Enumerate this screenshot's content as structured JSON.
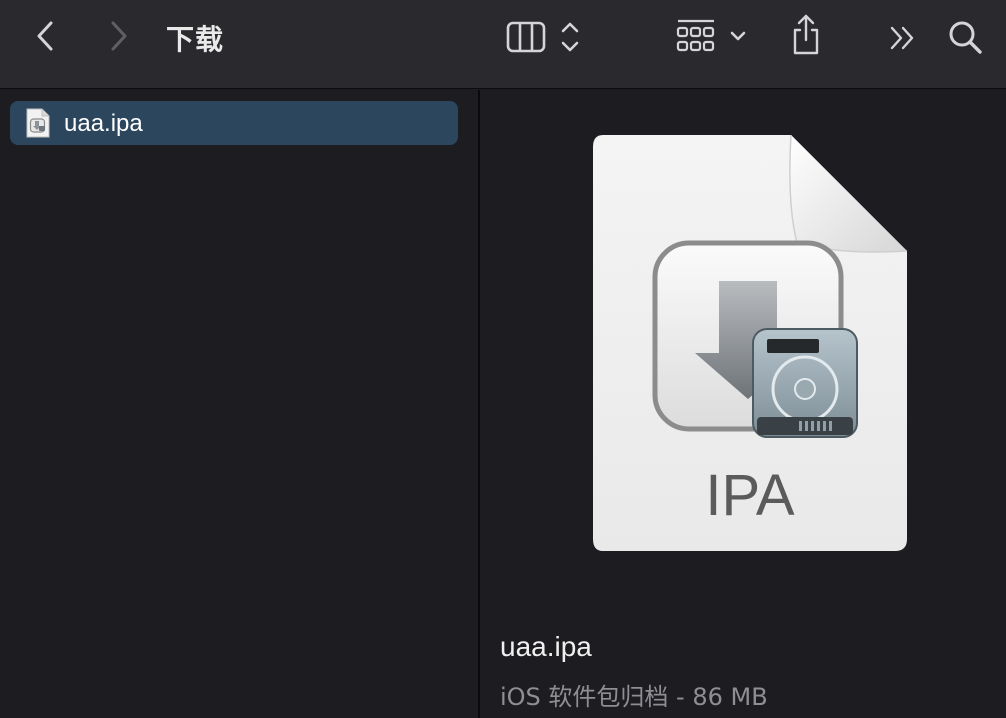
{
  "toolbar": {
    "title": "下载",
    "back_icon": "chevron-left-icon",
    "forward_icon": "chevron-right-icon",
    "view_icon": "column-view-icon",
    "group_icon": "grid-group-icon",
    "share_icon": "share-icon",
    "more_icon": "double-chevron-icon",
    "search_icon": "search-icon"
  },
  "sidebar_list": {
    "items": [
      {
        "name": "uaa.ipa",
        "icon": "ipa-file-icon",
        "selected": true
      }
    ]
  },
  "preview": {
    "icon_label": "IPA",
    "file_name": "uaa.ipa",
    "kind_size": "iOS 软件包归档 - 86 MB"
  },
  "colors": {
    "toolbar_bg": "#2a2a2e",
    "pane_bg": "#1c1c21",
    "selection": "#2c465e"
  }
}
